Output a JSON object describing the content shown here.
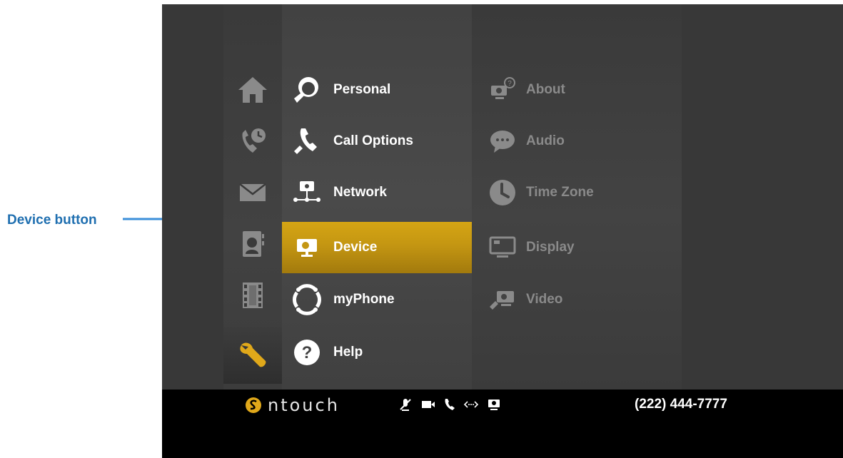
{
  "callout": {
    "label": "Device button",
    "color": "#1f6fb0"
  },
  "nav_icons": [
    {
      "name": "home-icon",
      "active": false
    },
    {
      "name": "call-history-icon",
      "active": false
    },
    {
      "name": "mail-icon",
      "active": false
    },
    {
      "name": "contacts-icon",
      "active": false
    },
    {
      "name": "video-center-icon",
      "active": false
    },
    {
      "name": "settings-wrench-icon",
      "active": true
    }
  ],
  "menu": {
    "items": [
      {
        "label": "Personal",
        "icon": "personal-settings-icon"
      },
      {
        "label": "Call Options",
        "icon": "call-options-icon"
      },
      {
        "label": "Network",
        "icon": "network-icon"
      },
      {
        "label": "Device",
        "icon": "device-icon",
        "selected": true
      },
      {
        "label": "myPhone",
        "icon": "myphone-icon"
      },
      {
        "label": "Help",
        "icon": "help-icon"
      }
    ],
    "selected_color": "#c49612"
  },
  "submenu": {
    "items": [
      {
        "label": "About",
        "icon": "about-icon"
      },
      {
        "label": "Audio",
        "icon": "audio-icon"
      },
      {
        "label": "Time Zone",
        "icon": "clock-icon"
      },
      {
        "label": "Display",
        "icon": "display-icon"
      },
      {
        "label": "Video",
        "icon": "video-settings-icon"
      }
    ]
  },
  "status_bar": {
    "brand": "ntouch",
    "phone_number": "(222) 444-7777",
    "icons": [
      "mic-muted-icon",
      "video-camera-icon",
      "phone-icon",
      "signal-icon",
      "device-status-icon"
    ]
  },
  "colors": {
    "accent": "#e0a81a",
    "background": "#383838"
  }
}
